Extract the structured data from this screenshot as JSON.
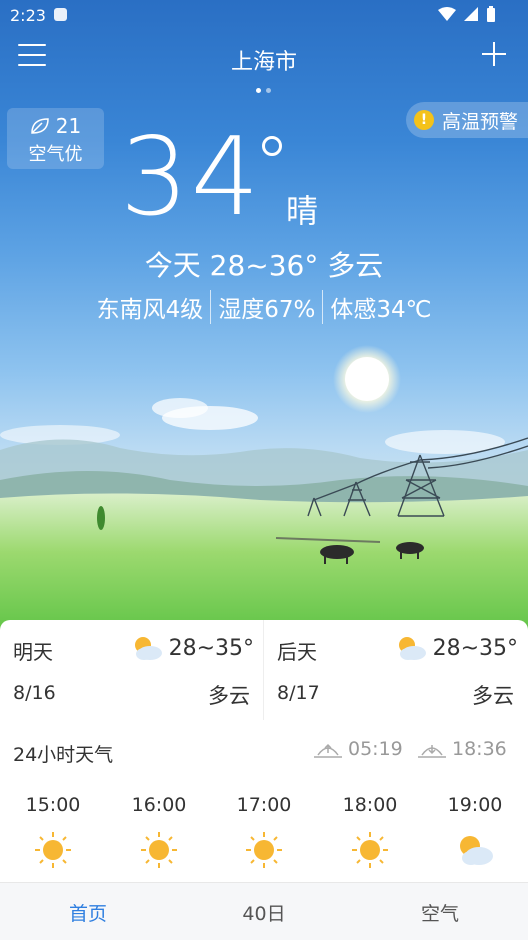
{
  "status_bar": {
    "time": "2:23"
  },
  "header": {
    "city": "上海市"
  },
  "aqi": {
    "value": "21",
    "label": "空气优"
  },
  "warning": {
    "text": "高温预警",
    "badge": "!"
  },
  "current": {
    "temperature": "34",
    "condition": "晴",
    "today_summary": "今天 28~36° 多云",
    "wind": "东南风4级",
    "humidity": "湿度67%",
    "feels_like": "体感34℃"
  },
  "forecast": [
    {
      "day": "明天",
      "date": "8/16",
      "range": "28~35°",
      "condition": "多云",
      "icon": "partly-cloudy-icon"
    },
    {
      "day": "后天",
      "date": "8/17",
      "range": "28~35°",
      "condition": "多云",
      "icon": "partly-cloudy-icon"
    }
  ],
  "hourly": {
    "title": "24小时天气",
    "sunrise": "05:19",
    "sunset": "18:36",
    "hours": [
      {
        "time": "15:00",
        "icon": "sun-icon"
      },
      {
        "time": "16:00",
        "icon": "sun-icon"
      },
      {
        "time": "17:00",
        "icon": "sun-icon"
      },
      {
        "time": "18:00",
        "icon": "sun-icon"
      },
      {
        "time": "19:00",
        "icon": "partly-cloudy-icon"
      }
    ]
  },
  "tabs": [
    {
      "label": "首页",
      "active": true
    },
    {
      "label": "40日",
      "active": false
    },
    {
      "label": "空气",
      "active": false
    }
  ],
  "colors": {
    "accent": "#2f7fe0",
    "sun": "#f7b733",
    "warning": "#f4c21a"
  }
}
